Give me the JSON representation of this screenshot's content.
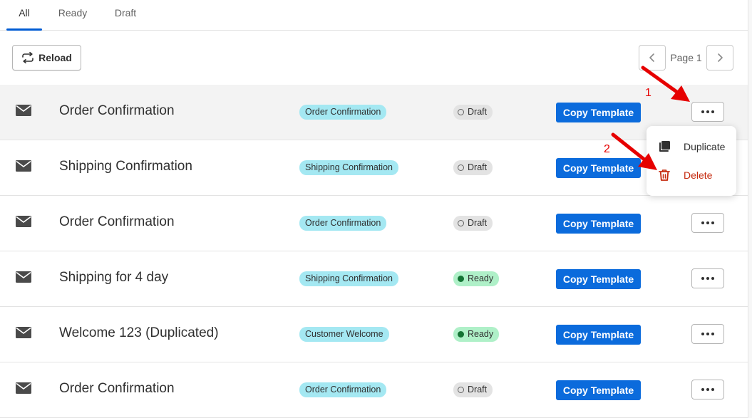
{
  "tabs": [
    {
      "label": "All",
      "active": true
    },
    {
      "label": "Ready",
      "active": false
    },
    {
      "label": "Draft",
      "active": false
    }
  ],
  "toolbar": {
    "reload_label": "Reload",
    "page_label": "Page 1"
  },
  "rows": [
    {
      "title": "Order Confirmation",
      "type": "Order Confirmation",
      "status": "Draft",
      "action": "Copy Template",
      "icon": "envelope-icon"
    },
    {
      "title": "Shipping Confirmation",
      "type": "Shipping Confirmation",
      "status": "Draft",
      "action": "Copy Template",
      "icon": "envelope-icon"
    },
    {
      "title": "Order Confirmation",
      "type": "Order Confirmation",
      "status": "Draft",
      "action": "Copy Template",
      "icon": "envelope-icon"
    },
    {
      "title": "Shipping for 4 day",
      "type": "Shipping Confirmation",
      "status": "Ready",
      "action": "Copy Template",
      "icon": "envelope-icon"
    },
    {
      "title": "Welcome 123 (Duplicated)",
      "type": "Customer Welcome",
      "status": "Ready",
      "action": "Copy Template",
      "icon": "envelope-icon"
    },
    {
      "title": "Order Confirmation",
      "type": "Order Confirmation",
      "status": "Draft",
      "action": "Copy Template",
      "icon": "envelope-icon"
    }
  ],
  "dropdown": {
    "duplicate_label": "Duplicate",
    "delete_label": "Delete"
  },
  "annotations": {
    "step1": "1",
    "step2": "2"
  },
  "colors": {
    "primary_button": "#0b6bdc",
    "type_badge": "#a4e8f2",
    "ready_badge": "#aff0c8",
    "draft_badge": "#e3e3e3",
    "delete_text": "#c5280c",
    "annotation_red": "#e60000"
  }
}
